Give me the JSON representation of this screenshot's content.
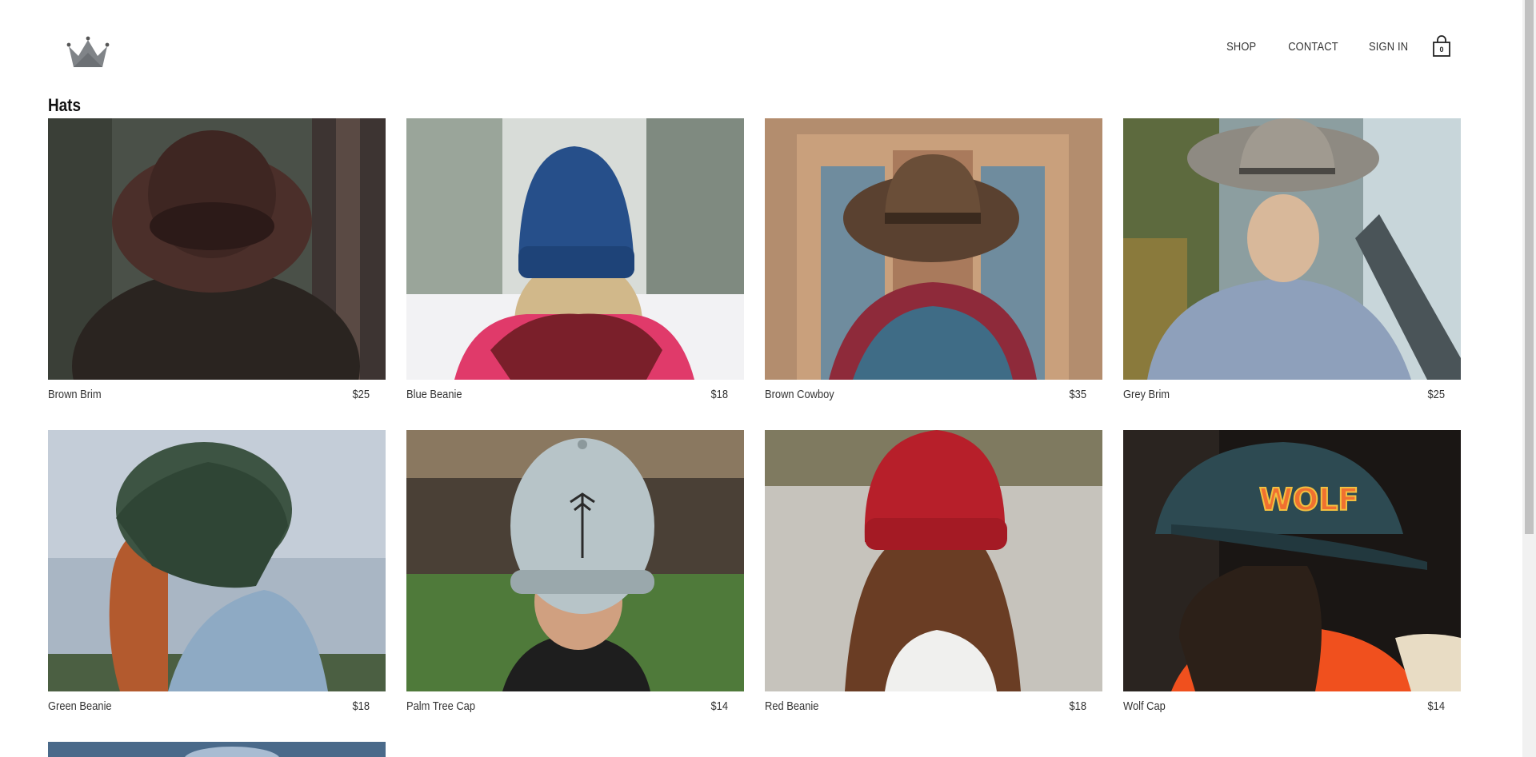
{
  "header": {
    "logo_icon": "crown-icon",
    "nav": [
      {
        "label": "SHOP"
      },
      {
        "label": "CONTACT"
      },
      {
        "label": "SIGN IN"
      }
    ],
    "cart_icon": "shopping-bag-icon",
    "cart_count": "0"
  },
  "collection": {
    "title": "Hats",
    "items": [
      {
        "name": "Brown Brim",
        "price": "$25"
      },
      {
        "name": "Blue Beanie",
        "price": "$18"
      },
      {
        "name": "Brown Cowboy",
        "price": "$35"
      },
      {
        "name": "Grey Brim",
        "price": "$25"
      },
      {
        "name": "Green Beanie",
        "price": "$18"
      },
      {
        "name": "Palm Tree Cap",
        "price": "$14"
      },
      {
        "name": "Red Beanie",
        "price": "$18"
      },
      {
        "name": "Wolf Cap",
        "price": "$14"
      }
    ]
  }
}
